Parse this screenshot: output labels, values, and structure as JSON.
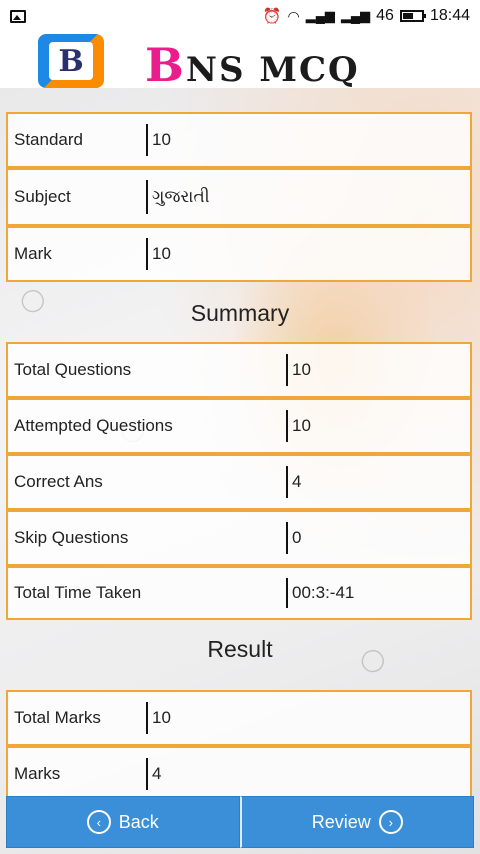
{
  "statusbar": {
    "time": "18:44",
    "network": "46",
    "icons": [
      "image-icon",
      "alarm-icon",
      "wifi-icon",
      "signal-icon",
      "signal-icon",
      "battery-icon"
    ]
  },
  "header": {
    "logo_letter": "B",
    "brand_initial": "B",
    "brand_rest": "NS MCQ"
  },
  "info": [
    {
      "label": "Standard",
      "value": "10"
    },
    {
      "label": "Subject",
      "value": "ગુજરાતી"
    },
    {
      "label": "Mark",
      "value": "10"
    }
  ],
  "summary": {
    "title": "Summary",
    "rows": [
      {
        "label": "Total Questions",
        "value": "10"
      },
      {
        "label": "Attempted Questions",
        "value": "10"
      },
      {
        "label": "Correct Ans",
        "value": "4"
      },
      {
        "label": "Skip Questions",
        "value": "0"
      },
      {
        "label": "Total Time Taken",
        "value": "00:3:-41"
      }
    ]
  },
  "result": {
    "title": "Result",
    "rows": [
      {
        "label": "Total Marks",
        "value": "10"
      },
      {
        "label": "Marks",
        "value": "4"
      }
    ]
  },
  "footer": {
    "back_label": "Back",
    "review_label": "Review"
  },
  "colors": {
    "row_border": "#f0a73a",
    "button_bg": "#3b8fd8",
    "brand_pink": "#e91e8c"
  }
}
